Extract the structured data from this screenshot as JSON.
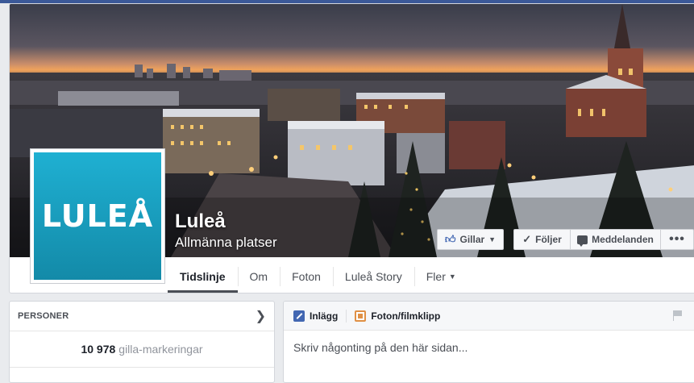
{
  "page": {
    "name": "Luleå",
    "category": "Allmänna platser",
    "logo_text": "LULEÅ"
  },
  "actions": {
    "like_label": "Gillar",
    "follow_label": "Följer",
    "message_label": "Meddelanden",
    "more_label": "•••"
  },
  "tabs": [
    {
      "label": "Tidslinje",
      "active": true
    },
    {
      "label": "Om"
    },
    {
      "label": "Foton"
    },
    {
      "label": "Luleå Story"
    },
    {
      "label": "Fler"
    }
  ],
  "people": {
    "title": "PERSONER",
    "likes_count": "10 978",
    "likes_label": "gilla-markeringar"
  },
  "composer": {
    "post_tab": "Inlägg",
    "photo_tab": "Foton/filmklipp",
    "placeholder": "Skriv någonting på den här sidan..."
  },
  "colors": {
    "brand": "#3b5998",
    "logo_bg": "#1fb0d2",
    "like_blue": "#4267b2"
  }
}
